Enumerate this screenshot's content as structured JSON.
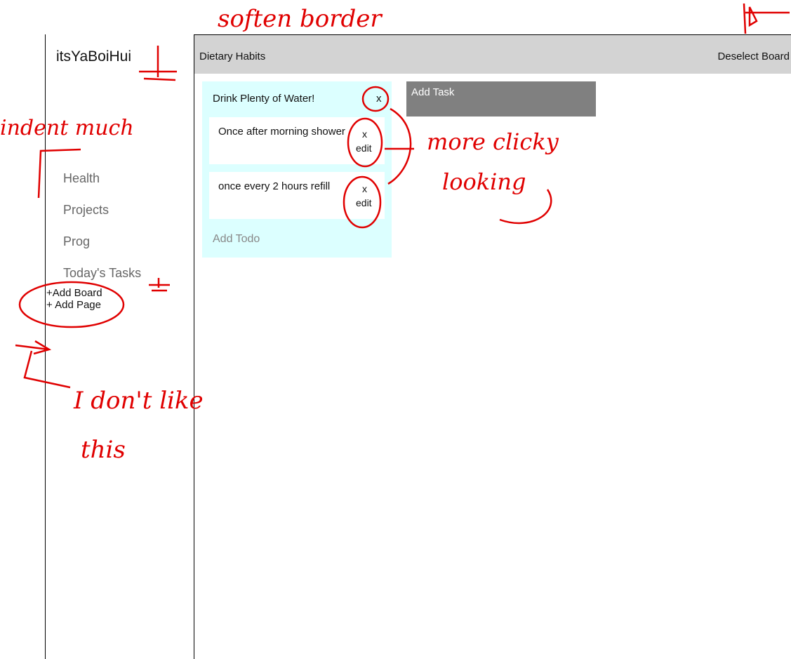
{
  "sidebar": {
    "username": "itsYaBoiHui",
    "items": [
      {
        "label": "Health"
      },
      {
        "label": "Projects"
      },
      {
        "label": "Prog"
      },
      {
        "label": "Today's Tasks"
      }
    ],
    "add_board": "+Add Board",
    "add_page": "+ Add Page"
  },
  "header": {
    "board_title": "Dietary Habits",
    "deselect_label": "Deselect Board"
  },
  "board": {
    "task": {
      "title": "Drink Plenty of Water!",
      "close_label": "x",
      "todos": [
        {
          "text": "Once after morning shower",
          "close_label": "x",
          "edit_label": "edit"
        },
        {
          "text": "once every 2 hours refill",
          "close_label": "x",
          "edit_label": "edit"
        }
      ],
      "add_todo_label": "Add Todo"
    },
    "add_task_label": "Add Task"
  },
  "annotations": {
    "soften_border": "soften border",
    "indent_much": "indent much",
    "more_clicky": "more clicky",
    "looking": "looking",
    "i_dont_like": "I don't like",
    "this": "this",
    "color": "#e00000"
  }
}
